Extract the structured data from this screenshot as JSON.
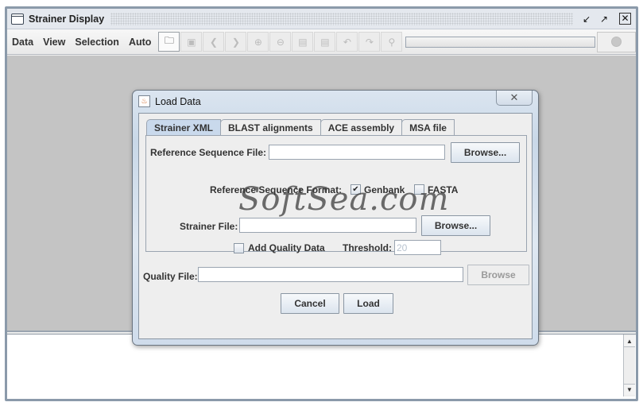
{
  "window": {
    "title": "Strainer Display",
    "controls": {
      "minimize": "↙",
      "maximize": "↗",
      "close": "✕"
    }
  },
  "menu": {
    "items": [
      "Data",
      "View",
      "Selection",
      "Auto"
    ]
  },
  "toolbar": {
    "buttons": [
      {
        "icon": "open-folder-icon",
        "glyph": "🗀",
        "enabled": true
      },
      {
        "icon": "save-icon",
        "glyph": "▣",
        "enabled": false
      },
      {
        "icon": "back-icon",
        "glyph": "❮",
        "enabled": false
      },
      {
        "icon": "forward-icon",
        "glyph": "❯",
        "enabled": false
      },
      {
        "icon": "zoom-in-icon",
        "glyph": "⊕",
        "enabled": false
      },
      {
        "icon": "zoom-out-icon",
        "glyph": "⊖",
        "enabled": false
      },
      {
        "icon": "document-settings-icon",
        "glyph": "▤",
        "enabled": false
      },
      {
        "icon": "document-add-icon",
        "glyph": "▤",
        "enabled": false
      },
      {
        "icon": "undo-icon",
        "glyph": "↶",
        "enabled": false
      },
      {
        "icon": "redo-icon",
        "glyph": "↷",
        "enabled": false
      },
      {
        "icon": "binoculars-icon",
        "glyph": "⚲",
        "enabled": false
      }
    ],
    "progress_percent": 0
  },
  "dialog": {
    "title": "Load Data",
    "close_glyph": "✕",
    "tabs": [
      "Strainer XML",
      "BLAST alignments",
      "ACE assembly",
      "MSA file"
    ],
    "active_tab": "Strainer XML",
    "reference_file": {
      "label": "Reference Sequence File:",
      "value": "",
      "browse": "Browse..."
    },
    "format": {
      "label": "Reference Sequence Format:",
      "genbank": {
        "label": "Genbank",
        "checked": true,
        "mark": "✔"
      },
      "fasta": {
        "label": "FASTA",
        "checked": false,
        "mark": ""
      }
    },
    "strainer_file": {
      "label": "Strainer File:",
      "value": "",
      "browse": "Browse..."
    },
    "quality": {
      "checkbox_label": "Add Quality Data",
      "checked": false,
      "threshold_label": "Threshold:",
      "threshold_value": "20",
      "file_label": "Quality File:",
      "file_value": "",
      "browse": "Browse"
    },
    "buttons": {
      "cancel": "Cancel",
      "load": "Load"
    }
  },
  "scrollbar": {
    "up": "▲",
    "down": "▼"
  },
  "watermark": "SoftSea.com"
}
